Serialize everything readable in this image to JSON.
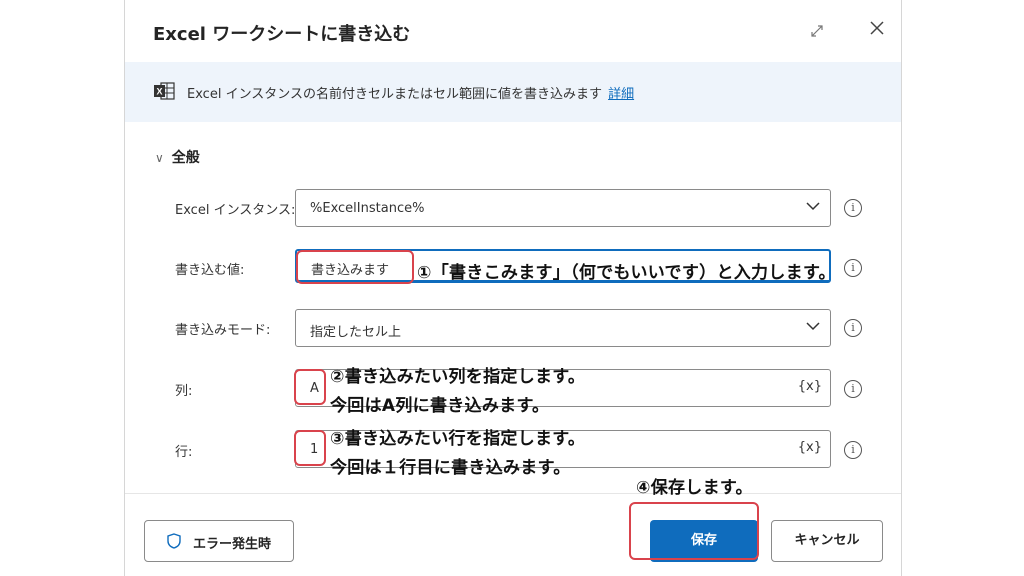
{
  "dialog": {
    "title": "Excel ワークシートに書き込む",
    "info_text": "Excel インスタンスの名前付きセルまたはセル範囲に値を書き込みます",
    "info_link": "詳細",
    "section_label": "全般"
  },
  "fields": {
    "instance": {
      "label": "Excel インスタンス:",
      "value": "%ExcelInstance%"
    },
    "value": {
      "label": "書き込む値:",
      "value": "書き込みます"
    },
    "mode": {
      "label": "書き込みモード:",
      "value": "指定したセル上"
    },
    "column": {
      "label": "列:",
      "value": "A",
      "var_button": "{x}"
    },
    "row": {
      "label": "行:",
      "value": "1",
      "var_button": "{x}"
    }
  },
  "annotations": {
    "a1": "①「書きこみます」（何でもいいです）と入力します。",
    "a2_line1": "②書き込みたい列を指定します。",
    "a2_line2": "今回はA列に書き込みます。",
    "a3_line1": "③書き込みたい行を指定します。",
    "a3_line2": "今回は１行目に書き込みます。",
    "a4": "④保存します。"
  },
  "footer": {
    "error_button": "エラー発生時",
    "save_button": "保存",
    "cancel_button": "キャンセル"
  },
  "icons": [
    "expand-icon",
    "close-icon",
    "excel-icon",
    "chevron-down-icon",
    "info-icon",
    "shield-icon"
  ],
  "colors": {
    "accent": "#0f6cbd",
    "highlight": "#d9434c",
    "infobar": "#eef4fb"
  }
}
